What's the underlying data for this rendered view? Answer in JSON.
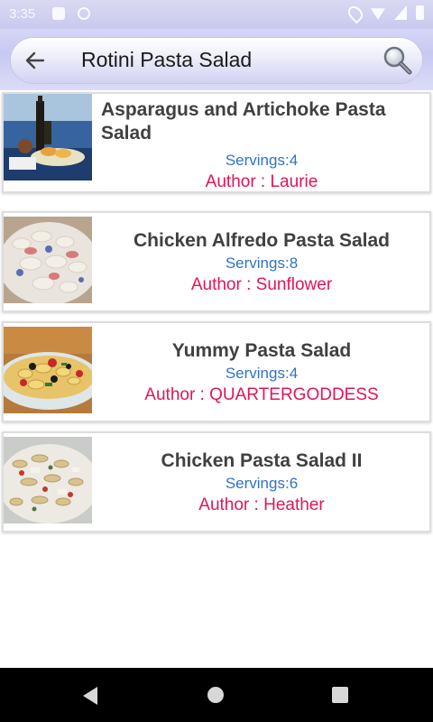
{
  "status_bar": {
    "time": "3:35"
  },
  "search": {
    "query": "Rotini Pasta Salad"
  },
  "results": [
    {
      "title": "Asparagus and Artichoke Pasta Salad",
      "servings": "Servings:4",
      "author": "Author : Laurie"
    },
    {
      "title": "Chicken Alfredo Pasta Salad",
      "servings": "Servings:8",
      "author": "Author : Sunflower"
    },
    {
      "title": "Yummy Pasta Salad",
      "servings": "Servings:4",
      "author": "Author : QUARTERGODDESS"
    },
    {
      "title": "Chicken Pasta Salad II",
      "servings": "Servings:6",
      "author": "Author : Heather"
    }
  ],
  "colors": {
    "title": "#404040",
    "servings": "#2f73c8",
    "author": "#e0155a",
    "app_bar": "#c8c8f2"
  },
  "icons": {
    "back": "arrow-left-icon",
    "search": "magnifier-icon"
  }
}
